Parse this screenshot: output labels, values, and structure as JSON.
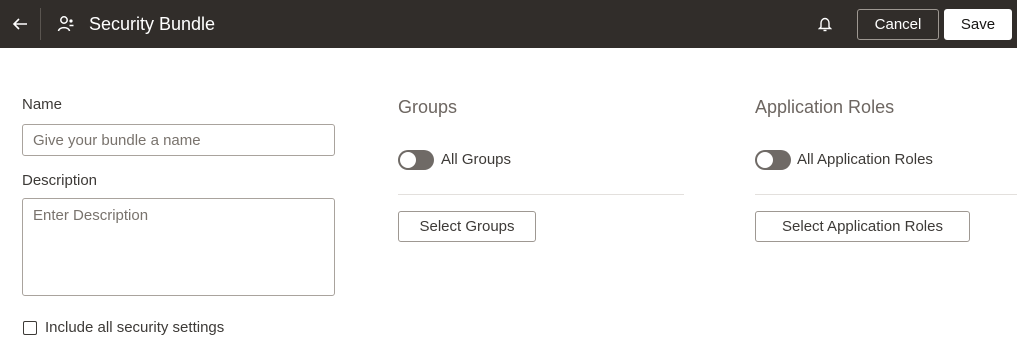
{
  "header": {
    "title": "Security Bundle",
    "cancel_label": "Cancel",
    "save_label": "Save",
    "icons": {
      "back": "back-arrow-icon",
      "title": "users-icon",
      "notifications": "bell-icon"
    }
  },
  "form": {
    "name_label": "Name",
    "name_placeholder": "Give your bundle a name",
    "name_value": "",
    "description_label": "Description",
    "description_placeholder": "Enter Description",
    "description_value": "",
    "include_all_label": "Include all security settings",
    "include_all_checked": false
  },
  "groups": {
    "heading": "Groups",
    "toggle_label": "All Groups",
    "toggle_on": false,
    "select_button_label": "Select Groups"
  },
  "roles": {
    "heading": "Application Roles",
    "toggle_label": "All Application Roles",
    "toggle_on": false,
    "select_button_label": "Select Application Roles"
  },
  "colors": {
    "header_bg": "#312d2a",
    "toggle_off": "#6f6a66",
    "heading_text": "#6d6661"
  }
}
